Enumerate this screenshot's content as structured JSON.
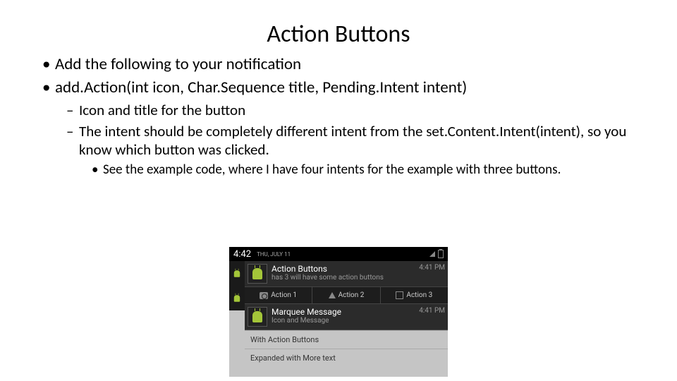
{
  "title": "Action Buttons",
  "bullets": {
    "level1": [
      "Add the following to your notification",
      "add.Action(int icon, Char.Sequence title, Pending.Intent intent)"
    ],
    "level2": [
      "Icon and title for the button",
      "The intent should be completely different intent from the set.Content.Intent(intent), so you know which button was clicked."
    ],
    "level3": [
      "See the example code, where I have four intents for the example with three buttons."
    ]
  },
  "mock": {
    "clock": "4:42",
    "date": "THU, JULY 11",
    "notifications": [
      {
        "title": "Action Buttons",
        "sub": "has 3 will have some action buttons",
        "time": "4:41 PM",
        "actions": [
          "Action 1",
          "Action 2",
          "Action 3"
        ]
      },
      {
        "title": "Marquee Message",
        "sub": "Icon and Message",
        "time": "4:41 PM"
      }
    ],
    "gray_rows": [
      "With Action Buttons",
      "Expanded with More text"
    ]
  }
}
